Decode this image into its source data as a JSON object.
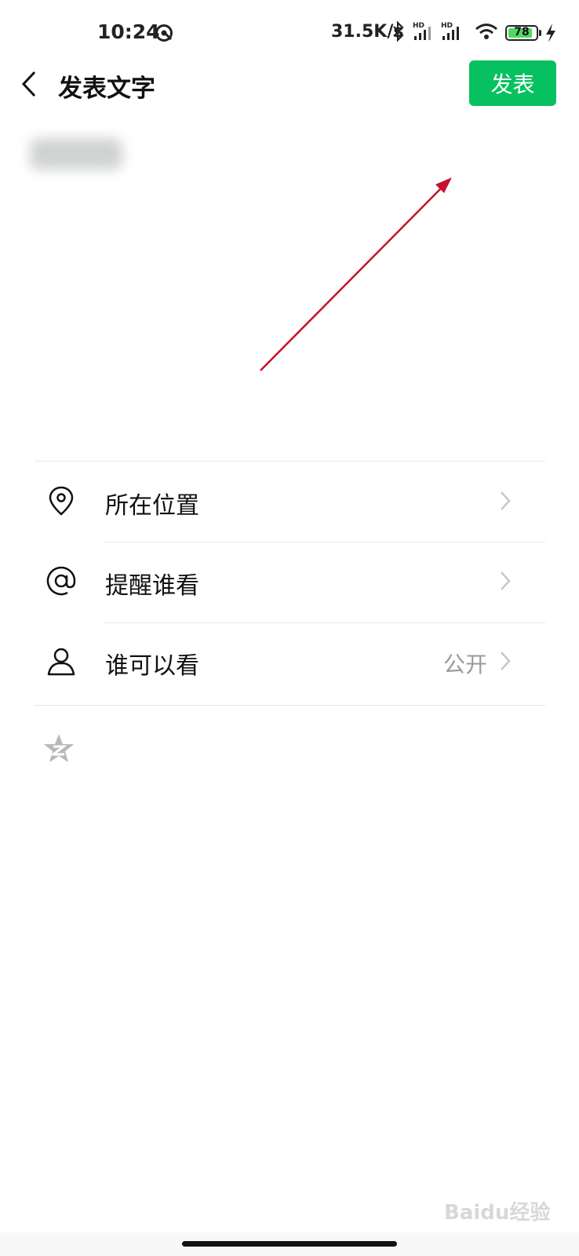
{
  "status_bar": {
    "time": "10:24",
    "network_speed": "31.5K/s",
    "battery_level": "78",
    "icons": [
      "do-not-disturb-icon",
      "bluetooth-icon",
      "signal-hd-icon",
      "signal-hd-icon",
      "wifi-icon",
      "battery-icon",
      "charging-icon"
    ]
  },
  "nav": {
    "title": "发表文字",
    "publish_label": "发表",
    "back_icon": "chevron-left-icon"
  },
  "menu": {
    "items": [
      {
        "label": "所在位置",
        "value": "",
        "icon": "location-pin-icon"
      },
      {
        "label": "提醒谁看",
        "value": "",
        "icon": "at-sign-icon"
      },
      {
        "label": "谁可以看",
        "value": "公开",
        "icon": "person-icon"
      }
    ]
  },
  "footer": {
    "share_icon": "qzone-star-icon",
    "watermark": "Baidu经验"
  },
  "colors": {
    "accent": "#07c160",
    "annotation_arrow": "#c8102e",
    "secondary_text": "#9a9a9a"
  }
}
